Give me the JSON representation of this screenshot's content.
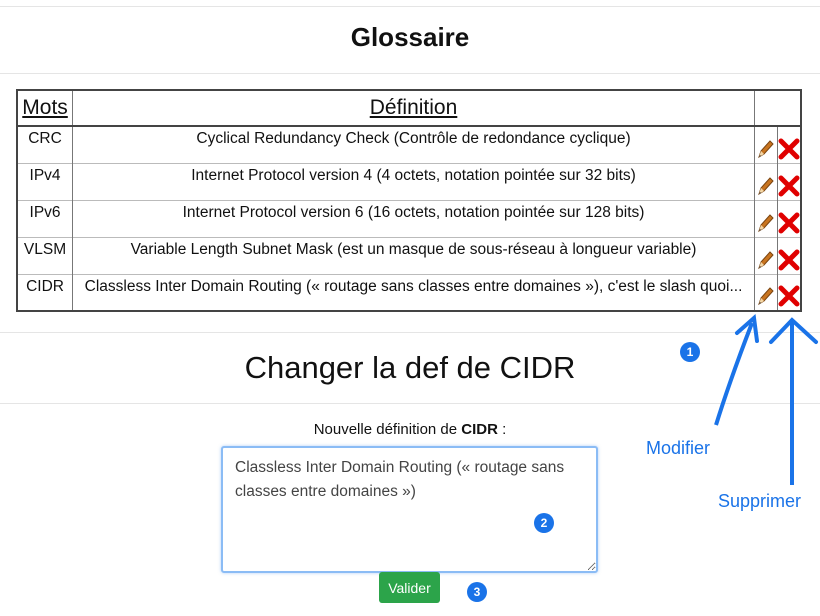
{
  "page": {
    "title": "Glossaire"
  },
  "glossary": {
    "headers": {
      "word": "Mots",
      "definition": "Définition"
    },
    "rows": [
      {
        "word": "CRC",
        "definition": "Cyclical Redundancy Check (Contrôle de redondance cyclique)"
      },
      {
        "word": "IPv4",
        "definition": "Internet Protocol version 4 (4 octets, notation pointée sur 32 bits)"
      },
      {
        "word": "IPv6",
        "definition": "Internet Protocol version 6 (16 octets, notation pointée sur 128 bits)"
      },
      {
        "word": "VLSM",
        "definition": "Variable Length Subnet Mask (est un masque de sous-réseau à longueur variable)"
      },
      {
        "word": "CIDR",
        "definition": "Classless Inter Domain Routing (« routage sans classes entre domaines »), c'est le slash quoi..."
      }
    ]
  },
  "edit_form": {
    "title": "Changer la def de CIDR",
    "label_prefix": "Nouvelle définition de",
    "label_term": "CIDR",
    "label_suffix": " :",
    "value": "Classless Inter Domain Routing (« routage sans classes entre domaines »)",
    "submit_label": "Valider"
  },
  "annotations": {
    "badge_1": "1",
    "badge_2": "2",
    "badge_3": "3",
    "modify_label": "Modifier",
    "delete_label": "Supprimer"
  },
  "icons": {
    "edit": "pencil-icon",
    "delete": "x-delete-icon"
  },
  "colors": {
    "accent": "#1a73e8",
    "submit": "#2ca44a",
    "delete": "#e00000",
    "pencil": "#b5651d"
  }
}
